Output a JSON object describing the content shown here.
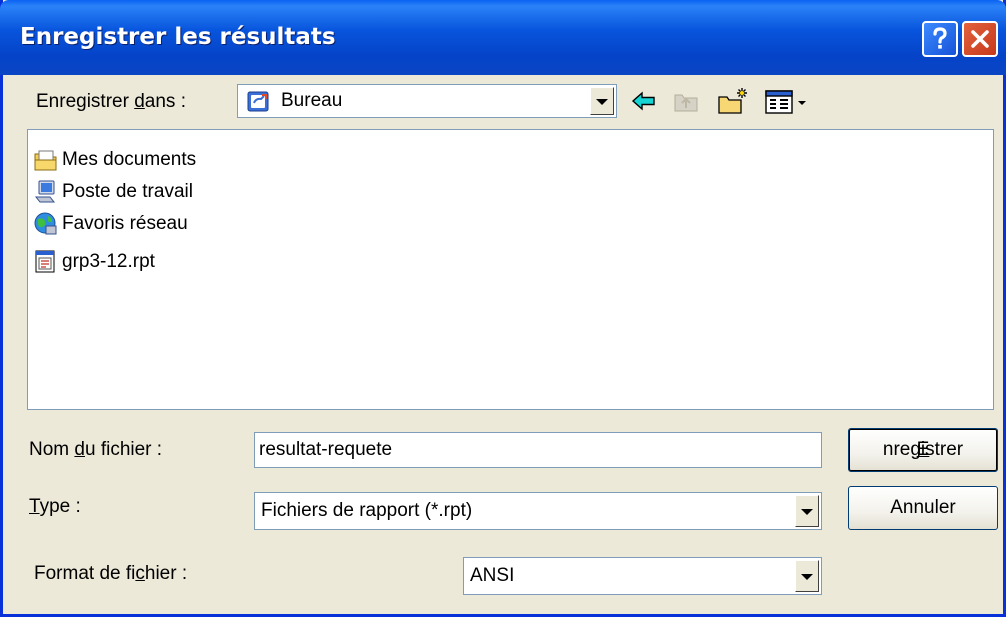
{
  "dialog": {
    "title": "Enregistrer les résultats"
  },
  "titlebar_buttons": {
    "help": "help-button",
    "close": "close-button"
  },
  "save_in": {
    "label_pre": "Enregistrer ",
    "label_key": "d",
    "label_post": "ans :",
    "value": "Bureau",
    "icon": "desktop-icon"
  },
  "toolbar": [
    {
      "icon": "back-arrow-icon"
    },
    {
      "icon": "up-one-level-icon"
    },
    {
      "icon": "new-folder-icon"
    },
    {
      "icon": "view-menu-icon"
    }
  ],
  "files": [
    {
      "name": "Mes documents",
      "icon": "my-documents-icon"
    },
    {
      "name": "Poste de travail",
      "icon": "my-computer-icon"
    },
    {
      "name": "Favoris réseau",
      "icon": "network-places-icon"
    },
    {
      "name": "grp3-12.rpt",
      "icon": "report-file-icon"
    }
  ],
  "filename": {
    "label_pre": "Nom ",
    "label_key": "d",
    "label_post": "u fichier :",
    "value": "resultat-requete"
  },
  "type": {
    "label_key": "T",
    "label_post": "ype :",
    "value": "Fichiers de rapport (*.rpt)"
  },
  "format": {
    "label_pre": "Format de fi",
    "label_key": "c",
    "label_post": "hier :",
    "value": "ANSI"
  },
  "buttons": {
    "save_key": "E",
    "save_rest": "nregistrer",
    "cancel": "Annuler"
  },
  "colors": {
    "titlebar": "#0855dd",
    "dialog_bg": "#ece9d8",
    "close": "#c6391c"
  }
}
